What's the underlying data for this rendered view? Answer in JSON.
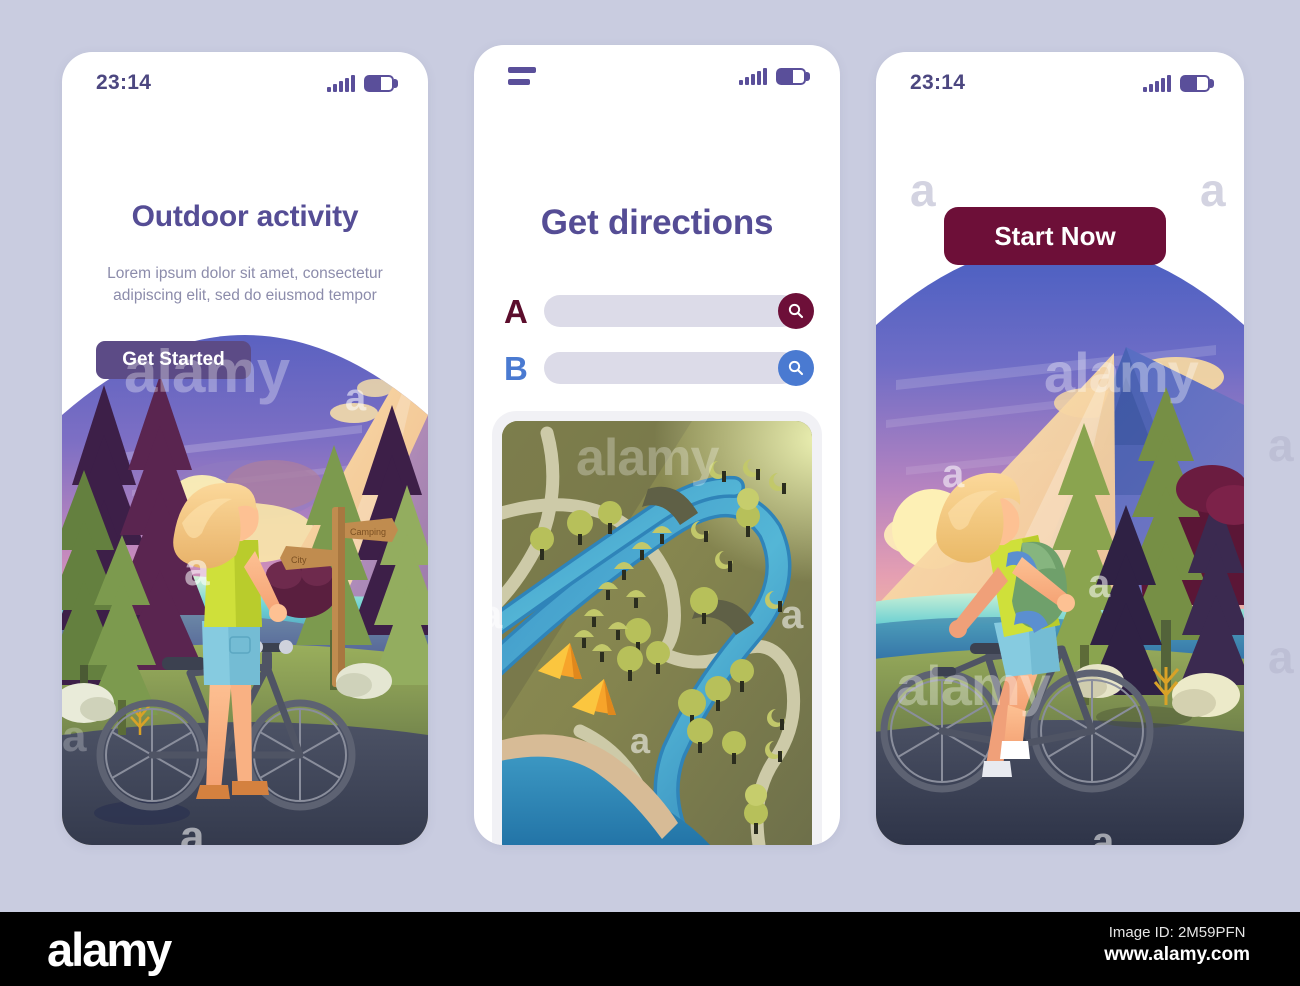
{
  "page": {
    "background_color": "#c9cce0",
    "accent_purple": "#554d95",
    "accent_maroon": "#6d0f38",
    "accent_blue": "#4a7ad1"
  },
  "screens": [
    {
      "id": "outdoor-activity",
      "status_bar": {
        "time": "23:14",
        "signal_icon": "signal-bars-icon",
        "battery_icon": "battery-icon"
      },
      "title": "Outdoor activity",
      "subtitle": "Lorem ipsum dolor sit amet, consectetur adipiscing elit, sed do eiusmod tempor",
      "primary_button": "Get Started",
      "illustration": {
        "name": "cyclist-standing-at-sunset-forest",
        "signpost": {
          "top_label": "Camping",
          "bottom_label": "City"
        }
      }
    },
    {
      "id": "get-directions",
      "status_bar": {
        "menu_icon": "hamburger-menu-icon",
        "signal_icon": "signal-bars-icon",
        "battery_icon": "battery-icon"
      },
      "title": "Get directions",
      "fields": [
        {
          "label": "A",
          "value": "",
          "placeholder": "",
          "label_color": "#5c0d2c",
          "button_color": "#6d0f38",
          "button_icon": "search-icon"
        },
        {
          "label": "B",
          "value": "",
          "placeholder": "",
          "label_color": "#4a7ad1",
          "button_color": "#4a7ad1",
          "button_icon": "search-icon"
        }
      ],
      "map": {
        "name": "top-down-route-map",
        "features": [
          "river",
          "roads",
          "bridges",
          "pine-trees",
          "round-trees",
          "orange-tents",
          "lake"
        ]
      }
    },
    {
      "id": "start-now",
      "status_bar": {
        "time": "23:14",
        "signal_icon": "signal-bars-icon",
        "battery_icon": "battery-icon"
      },
      "primary_button": "Start Now",
      "illustration": {
        "name": "cyclist-riding-past-mountain-at-sunset"
      }
    }
  ],
  "watermarks": {
    "brand": "alamy",
    "letter": "a"
  },
  "footer": {
    "logo": "alamy",
    "image_id": "Image ID: 2M59PFN",
    "url": "www.alamy.com"
  }
}
